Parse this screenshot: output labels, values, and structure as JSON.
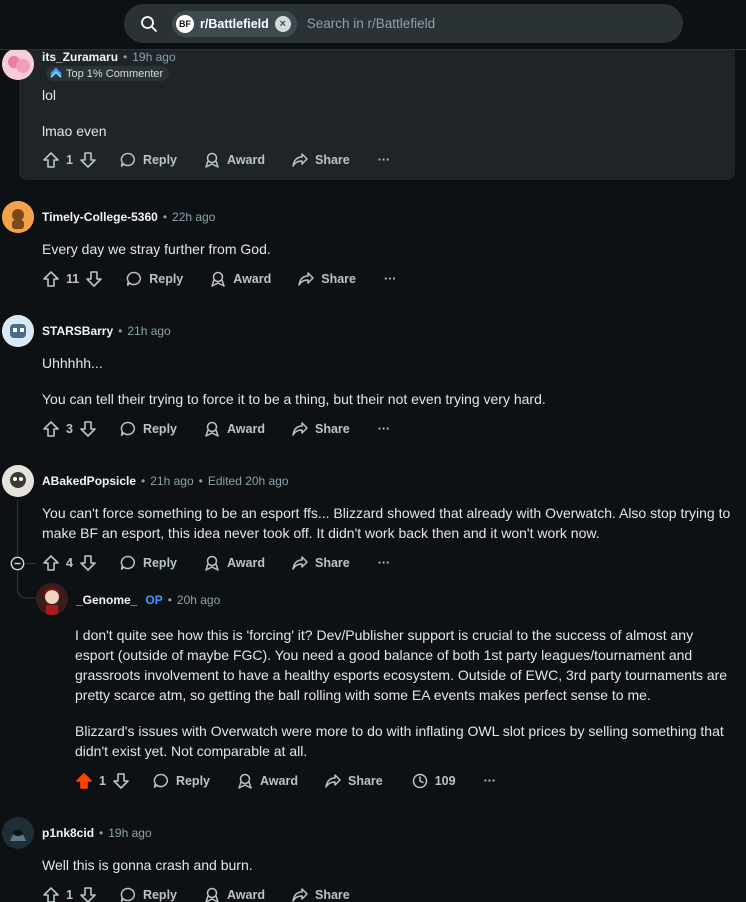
{
  "search": {
    "community_chip": "r/Battlefield",
    "community_badge": "BF",
    "placeholder": "Search in r/Battlefield"
  },
  "actions_labels": {
    "reply": "Reply",
    "award": "Award",
    "share": "Share",
    "more": "···"
  },
  "comments": [
    {
      "user": "its_Zuramaru",
      "time": "19h ago",
      "flair": "Top 1% Commenter",
      "paragraphs": [
        "lol",
        "lmao even"
      ],
      "votes": "1"
    },
    {
      "user": "Timely-College-5360",
      "time": "22h ago",
      "paragraphs": [
        "Every day we stray further from God."
      ],
      "votes": "11"
    },
    {
      "user": "STARSBarry",
      "time": "21h ago",
      "paragraphs": [
        "Uhhhhh...",
        "You can tell their trying to force it to be a thing, but their not even trying very hard."
      ],
      "votes": "3"
    },
    {
      "user": "ABakedPopsicle",
      "time": "21h ago",
      "edited": "Edited 20h ago",
      "paragraphs": [
        "You can't force something to be an esport ffs... Blizzard showed that already with Overwatch. Also stop trying to make BF an esport, this idea never took off. It didn't work back then and it won't work now."
      ],
      "votes": "4"
    },
    {
      "user": "_Genome_",
      "op": "OP",
      "time": "20h ago",
      "paragraphs": [
        "I don't quite see how this is 'forcing' it? Dev/Publisher support is crucial to the success of almost any esport (outside of maybe FGC). You need a good balance of both 1st party leagues/tournament and grassroots involvement to have a healthy esports ecosystem. Outside of EWC, 3rd party tournaments are pretty scarce atm, so getting the ball rolling with some EA events makes perfect sense to me.",
        "Blizzard's issues with Overwatch were more to do with inflating OWL slot prices by selling something that didn't exist yet. Not comparable at all."
      ],
      "votes": "1",
      "views": "109",
      "upvote_color": "#ff4500"
    },
    {
      "user": "p1nk8cid",
      "time": "19h ago",
      "paragraphs": [
        "Well this is gonna crash and burn."
      ],
      "votes": "1"
    }
  ]
}
